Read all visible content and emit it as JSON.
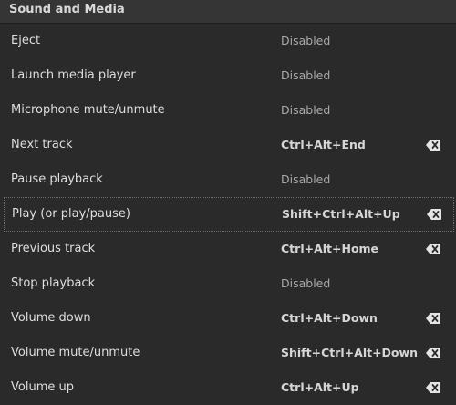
{
  "section": {
    "title": "Sound and Media"
  },
  "shortcuts": [
    {
      "name": "Eject",
      "accel": "Disabled",
      "set": false
    },
    {
      "name": "Launch media player",
      "accel": "Disabled",
      "set": false
    },
    {
      "name": "Microphone mute/unmute",
      "accel": "Disabled",
      "set": false
    },
    {
      "name": "Next track",
      "accel": "Ctrl+Alt+End",
      "set": true
    },
    {
      "name": "Pause playback",
      "accel": "Disabled",
      "set": false
    },
    {
      "name": "Play (or play/pause)",
      "accel": "Shift+Ctrl+Alt+Up",
      "set": true,
      "focused": true
    },
    {
      "name": "Previous track",
      "accel": "Ctrl+Alt+Home",
      "set": true
    },
    {
      "name": "Stop playback",
      "accel": "Disabled",
      "set": false
    },
    {
      "name": "Volume down",
      "accel": "Ctrl+Alt+Down",
      "set": true
    },
    {
      "name": "Volume mute/unmute",
      "accel": "Shift+Ctrl+Alt+Down",
      "set": true
    },
    {
      "name": "Volume up",
      "accel": "Ctrl+Alt+Up",
      "set": true
    }
  ],
  "icons": {
    "clear": "edit-clear-icon"
  },
  "colors": {
    "background": "#2a2a2a",
    "header_background": "#353535",
    "text": "#dedede",
    "disabled_text": "#a9a9a9"
  }
}
